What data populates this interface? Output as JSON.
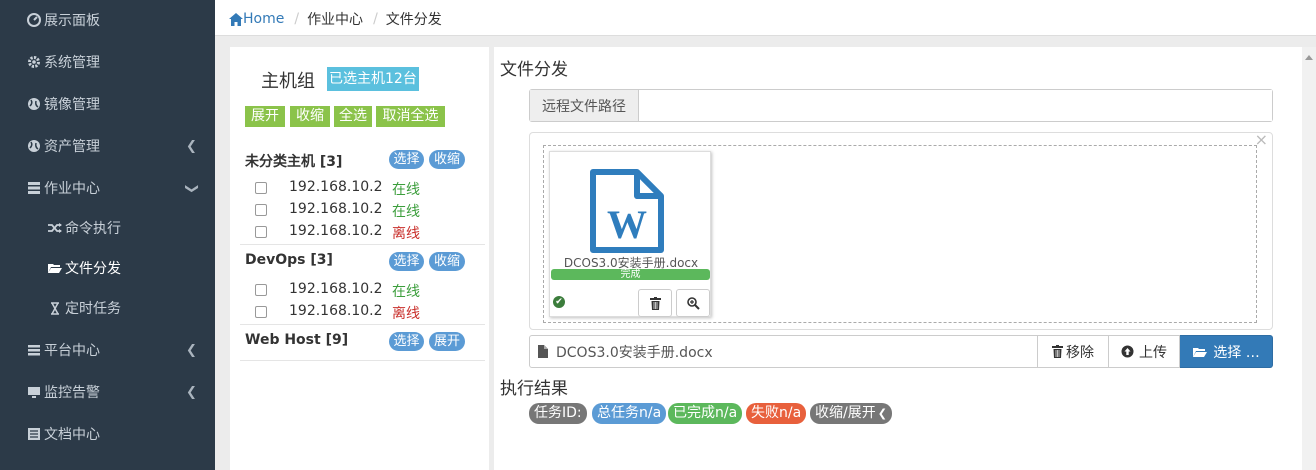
{
  "sidebar": {
    "items": [
      {
        "icon": "dashboard-icon",
        "label": "展示面板"
      },
      {
        "icon": "gear-icon",
        "label": "系统管理"
      },
      {
        "icon": "globe-icon",
        "label": "镜像管理"
      },
      {
        "icon": "globe-icon",
        "label": "资产管理"
      },
      {
        "icon": "server-icon",
        "label": "作业中心"
      },
      {
        "icon": "random-icon",
        "label": "命令执行"
      },
      {
        "icon": "folder-open-icon",
        "label": "文件分发"
      },
      {
        "icon": "hourglass-icon",
        "label": "定时任务"
      },
      {
        "icon": "list-icon",
        "label": "平台中心"
      },
      {
        "icon": "monitor-icon",
        "label": "监控告警"
      },
      {
        "icon": "book-icon",
        "label": "文档中心"
      }
    ]
  },
  "breadcrumb": {
    "home": "Home",
    "level1": "作业中心",
    "level2": "文件分发"
  },
  "host_panel": {
    "title": "主机组",
    "selected_badge": "已选主机12台",
    "actions": {
      "expand": "展开",
      "collapse": "收缩",
      "select_all": "全选",
      "deselect_all": "取消全选"
    },
    "select_label": "选择",
    "collapse_label": "收缩",
    "expand_label": "展开",
    "groups": [
      {
        "name": "未分类主机 [3]",
        "hosts": [
          {
            "ip": "192.168.10.2",
            "status": "在线"
          },
          {
            "ip": "192.168.10.2",
            "status": "在线"
          },
          {
            "ip": "192.168.10.2",
            "status": "离线"
          }
        ]
      },
      {
        "name": "DevOps [3]",
        "hosts": [
          {
            "ip": "192.168.10.2",
            "status": "在线"
          },
          {
            "ip": "192.168.10.2",
            "status": "离线"
          }
        ]
      },
      {
        "name": "Web Host [9]",
        "hosts": []
      }
    ]
  },
  "distribution": {
    "title": "文件分发",
    "remote_path_label": "远程文件路径",
    "remote_path_value": "",
    "preview": {
      "file_name": "DCOS3.0安装手册.docx",
      "progress_label": "完成",
      "progress": 1.0,
      "close": "×"
    },
    "file_input_value": "DCOS3.0安装手册.docx",
    "remove_label": "移除",
    "upload_label": "上传",
    "browse_label": "选择 …"
  },
  "results": {
    "title": "执行结果",
    "task_id": "任务ID:",
    "total": "总任务n/a",
    "done": "已完成n/a",
    "failed": "失败n/a",
    "toggle": "收缩/展开"
  },
  "colors": {
    "sidebar": "#2c3a48",
    "badge_info": "#5bc0de",
    "action_green": "#8bc34a",
    "pill_blue": "#5b9bd5",
    "primary": "#337ab7",
    "success": "#5cb85c",
    "danger": "#e8603c",
    "gray": "#777777"
  }
}
